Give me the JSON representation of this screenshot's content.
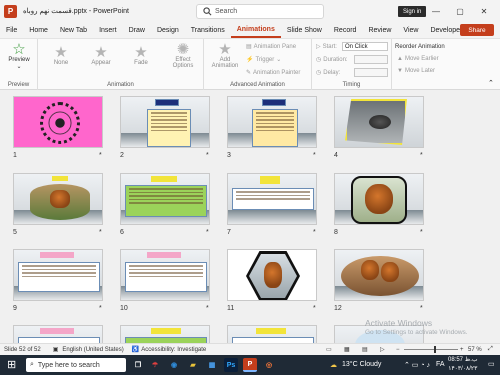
{
  "app": {
    "title": "قسمت نهم روباه.pptx - PowerPoint",
    "logo_letter": "P",
    "search_placeholder": "Search",
    "signin": "Sign in",
    "share": "Share",
    "brand_color": "#c43e1c"
  },
  "tabs": [
    "File",
    "Home",
    "New Tab",
    "Insert",
    "Draw",
    "Design",
    "Transitions",
    "Animations",
    "Slide Show",
    "Record",
    "Review",
    "View",
    "Developer"
  ],
  "active_tab": "Animations",
  "ribbon": {
    "preview": {
      "label": "Preview",
      "group": "Preview"
    },
    "animation": {
      "items": [
        "None",
        "Appear",
        "Fade"
      ],
      "effect_options": "Effect Options",
      "group": "Animation"
    },
    "advanced": {
      "add": "Add Animation",
      "pane": "Animation Pane",
      "trigger": "Trigger",
      "painter": "Animation Painter",
      "group": "Advanced Animation"
    },
    "timing": {
      "start_label": "Start:",
      "start_value": "On Click",
      "duration_label": "Duration:",
      "delay_label": "Delay:",
      "group": "Timing"
    },
    "reorder": {
      "title": "Reorder Animation",
      "earlier": "Move Earlier",
      "later": "Move Later"
    }
  },
  "slides": [
    {
      "num": "1",
      "star": "*"
    },
    {
      "num": "2",
      "star": "*"
    },
    {
      "num": "3",
      "star": "*"
    },
    {
      "num": "4",
      "star": "*"
    },
    {
      "num": "5",
      "star": "*"
    },
    {
      "num": "6",
      "star": "*"
    },
    {
      "num": "7",
      "star": "*"
    },
    {
      "num": "8",
      "star": "*"
    },
    {
      "num": "9",
      "star": "*"
    },
    {
      "num": "10",
      "star": "*"
    },
    {
      "num": "11",
      "star": "*"
    },
    {
      "num": "12",
      "star": "*"
    }
  ],
  "status": {
    "slide": "Slide 52 of 52",
    "language": "English (United States)",
    "accessibility": "Accessibility: Investigate",
    "zoom": "57 %"
  },
  "watermark": {
    "line1": "Activate Windows",
    "line2": "Go to Settings to activate Windows."
  },
  "taskbar": {
    "search": "Type here to search",
    "weather": "13°C  Cloudy",
    "time": "08:57 ب.ظ",
    "date": "۱۴۰۳/۰۸/۲۳",
    "lang": "FA"
  }
}
